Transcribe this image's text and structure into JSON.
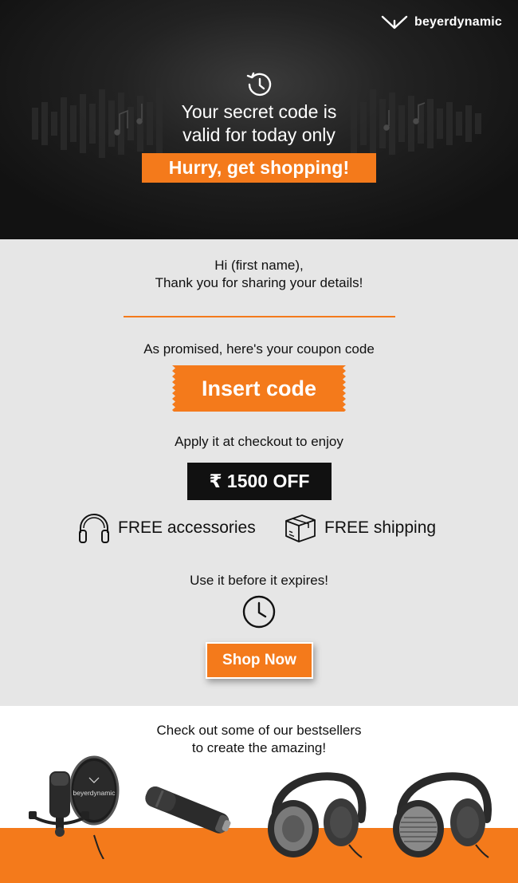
{
  "brand": {
    "name": "beyerdynamic"
  },
  "hero": {
    "headline_line1": "Your secret code is",
    "headline_line2": "valid for today only",
    "cta": "Hurry, get shopping!"
  },
  "main": {
    "greeting_line1": "Hi (first name),",
    "greeting_line2": "Thank you for sharing your details!",
    "promise_text": "As promised, here's your coupon code",
    "coupon_code": "Insert code",
    "apply_text": "Apply it at checkout to enjoy",
    "discount": "₹ 1500 OFF",
    "perks": [
      {
        "label": "FREE accessories",
        "icon": "headphones-icon"
      },
      {
        "label": "FREE shipping",
        "icon": "box-icon"
      }
    ],
    "expiry_text": "Use it before it expires!",
    "shop_button": "Shop Now"
  },
  "bestsellers": {
    "title_line1": "Check out some of our bestsellers",
    "title_line2": "to create the amazing!",
    "products": [
      {
        "icon": "microphone-with-pop-filter-image",
        "logo_text": "beyerdynamic"
      },
      {
        "icon": "studio-microphone-image"
      },
      {
        "icon": "closed-back-headphones-image"
      },
      {
        "icon": "open-back-headphones-image"
      }
    ]
  },
  "colors": {
    "accent": "#f47a1b",
    "dark": "#111111",
    "light_bg": "#e6e6e6"
  }
}
